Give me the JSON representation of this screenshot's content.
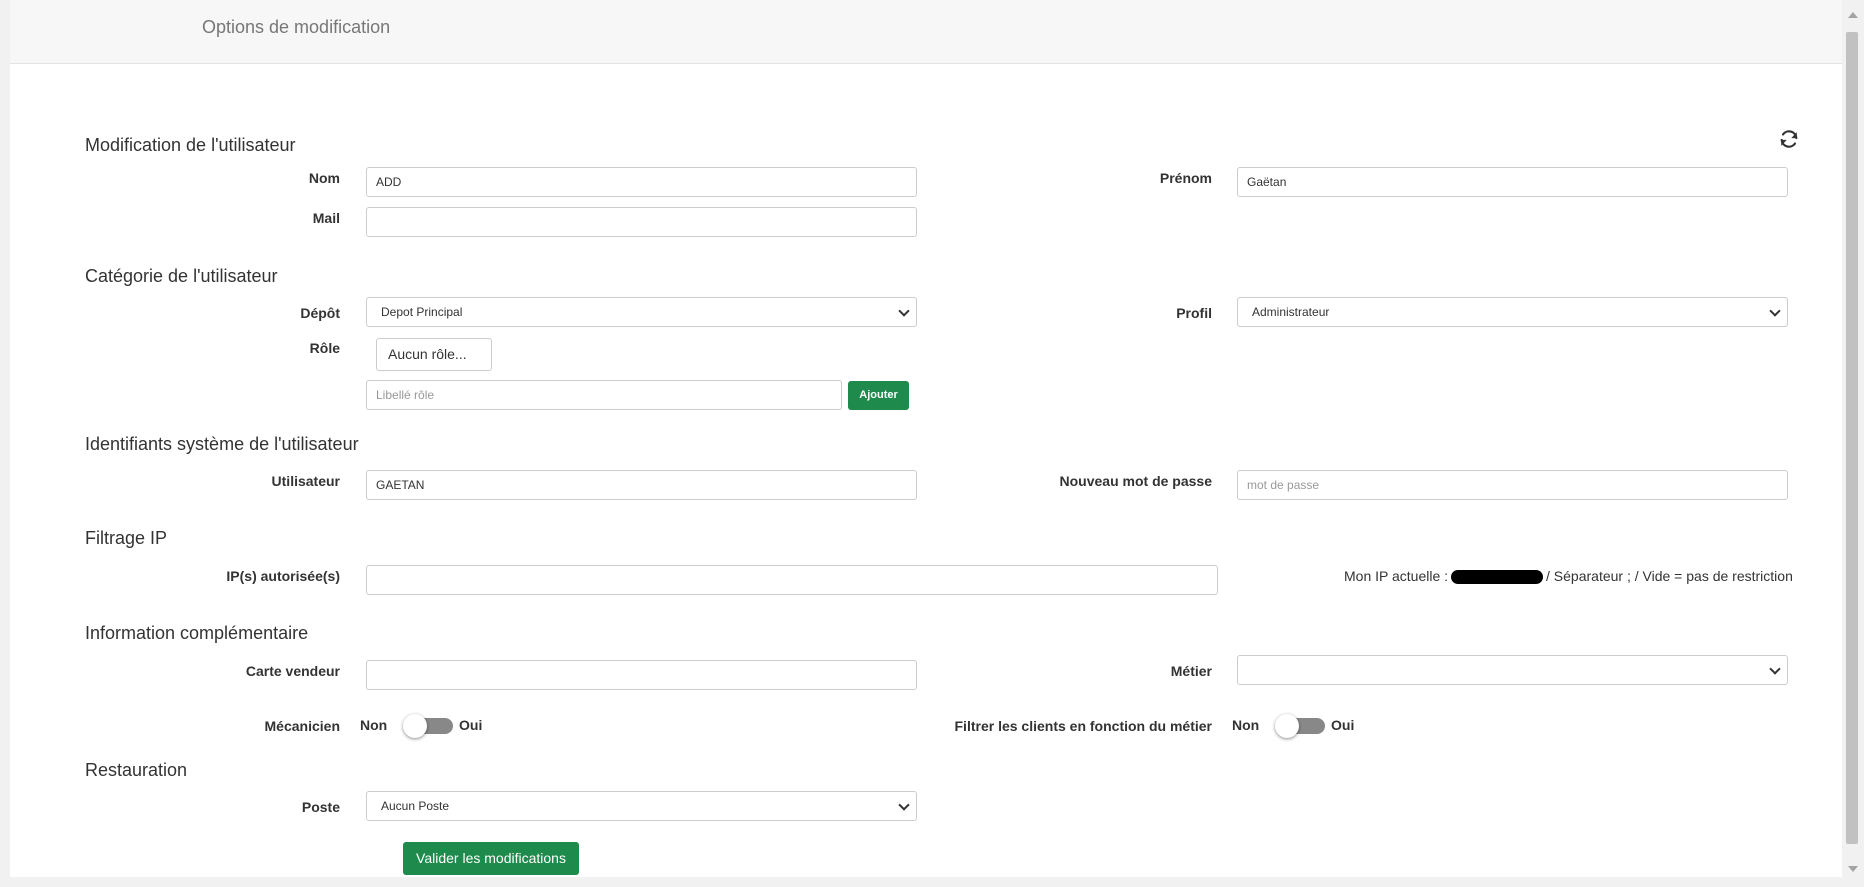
{
  "header": {
    "title": "Options de modification"
  },
  "sections": {
    "user_edit": "Modification de l'utilisateur",
    "category": "Catégorie de l'utilisateur",
    "system_ids": "Identifiants système de l'utilisateur",
    "ip_filter": "Filtrage IP",
    "additional_info": "Information complémentaire",
    "restoration": "Restauration"
  },
  "user": {
    "nom_label": "Nom",
    "nom_value": "ADD",
    "prenom_label": "Prénom",
    "prenom_value": "Gaëtan",
    "mail_label": "Mail",
    "mail_value": ""
  },
  "category": {
    "depot_label": "Dépôt",
    "depot_value": "Depot Principal",
    "profil_label": "Profil",
    "profil_value": "Administrateur",
    "role_label": "Rôle",
    "role_button": "Aucun rôle...",
    "role_input_placeholder": "Libellé rôle",
    "add_button": "Ajouter"
  },
  "system": {
    "user_label": "Utilisateur",
    "user_value": "GAETAN",
    "password_label": "Nouveau mot de passe",
    "password_placeholder": "mot de passe"
  },
  "ip": {
    "label": "IP(s) autorisée(s)",
    "value": "",
    "info_prefix": "Mon IP actuelle :",
    "info_suffix": "/ Séparateur ; / Vide = pas de restriction"
  },
  "additional": {
    "seller_card_label": "Carte vendeur",
    "seller_card_value": "",
    "job_label": "Métier",
    "job_value": "",
    "mechanic_label": "Mécanicien",
    "filter_clients_label": "Filtrer les clients en fonction du métier",
    "toggle_off": "Non",
    "toggle_on": "Oui",
    "mechanic_state": "Non",
    "filter_clients_state": "Non"
  },
  "restoration": {
    "poste_label": "Poste",
    "poste_value": "Aucun Poste"
  },
  "submit_button": "Valider les modifications",
  "colors": {
    "primary_button": "#1e8a4c",
    "toggle_track": "#888888"
  },
  "icons": {
    "refresh": "refresh-icon"
  }
}
